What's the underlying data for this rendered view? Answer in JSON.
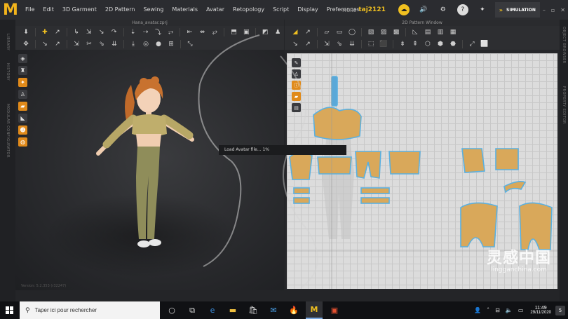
{
  "menu": [
    "File",
    "Edit",
    "3D Garment",
    "2D Pattern",
    "Sewing",
    "Materials",
    "Avatar",
    "Retopology",
    "Script",
    "Display",
    "Preferences"
  ],
  "user": {
    "greeting": "Hello",
    "name": "taj2121"
  },
  "simulation_label": "SIMULATION",
  "win3d": {
    "title": "Hana_avatar.zprj",
    "version": "Version: 5.2.353 (r32247)"
  },
  "win2d": {
    "title": "2D Pattern Window"
  },
  "side_labels": {
    "left1": "LIBRARY",
    "left2": "HISTORY",
    "left3": "MODULAR CONFIGURATOR",
    "right1": "OBJECT BROWSER",
    "right2": "PROPERTY EDITOR"
  },
  "loading_text": "Load Avatar file... 1%",
  "watermark": {
    "main": "灵感中国",
    "sub": "lingganchina.com"
  },
  "taskbar": {
    "search_placeholder": "Taper ici pour rechercher",
    "time": "11:49",
    "date": "29/11/2020",
    "notifications": "5"
  },
  "colors": {
    "accent": "#f0c020",
    "pattern_fill": "#d9a85a",
    "pattern_outline": "#5ab0e0",
    "viewport_bg": "#2b2c2f"
  }
}
